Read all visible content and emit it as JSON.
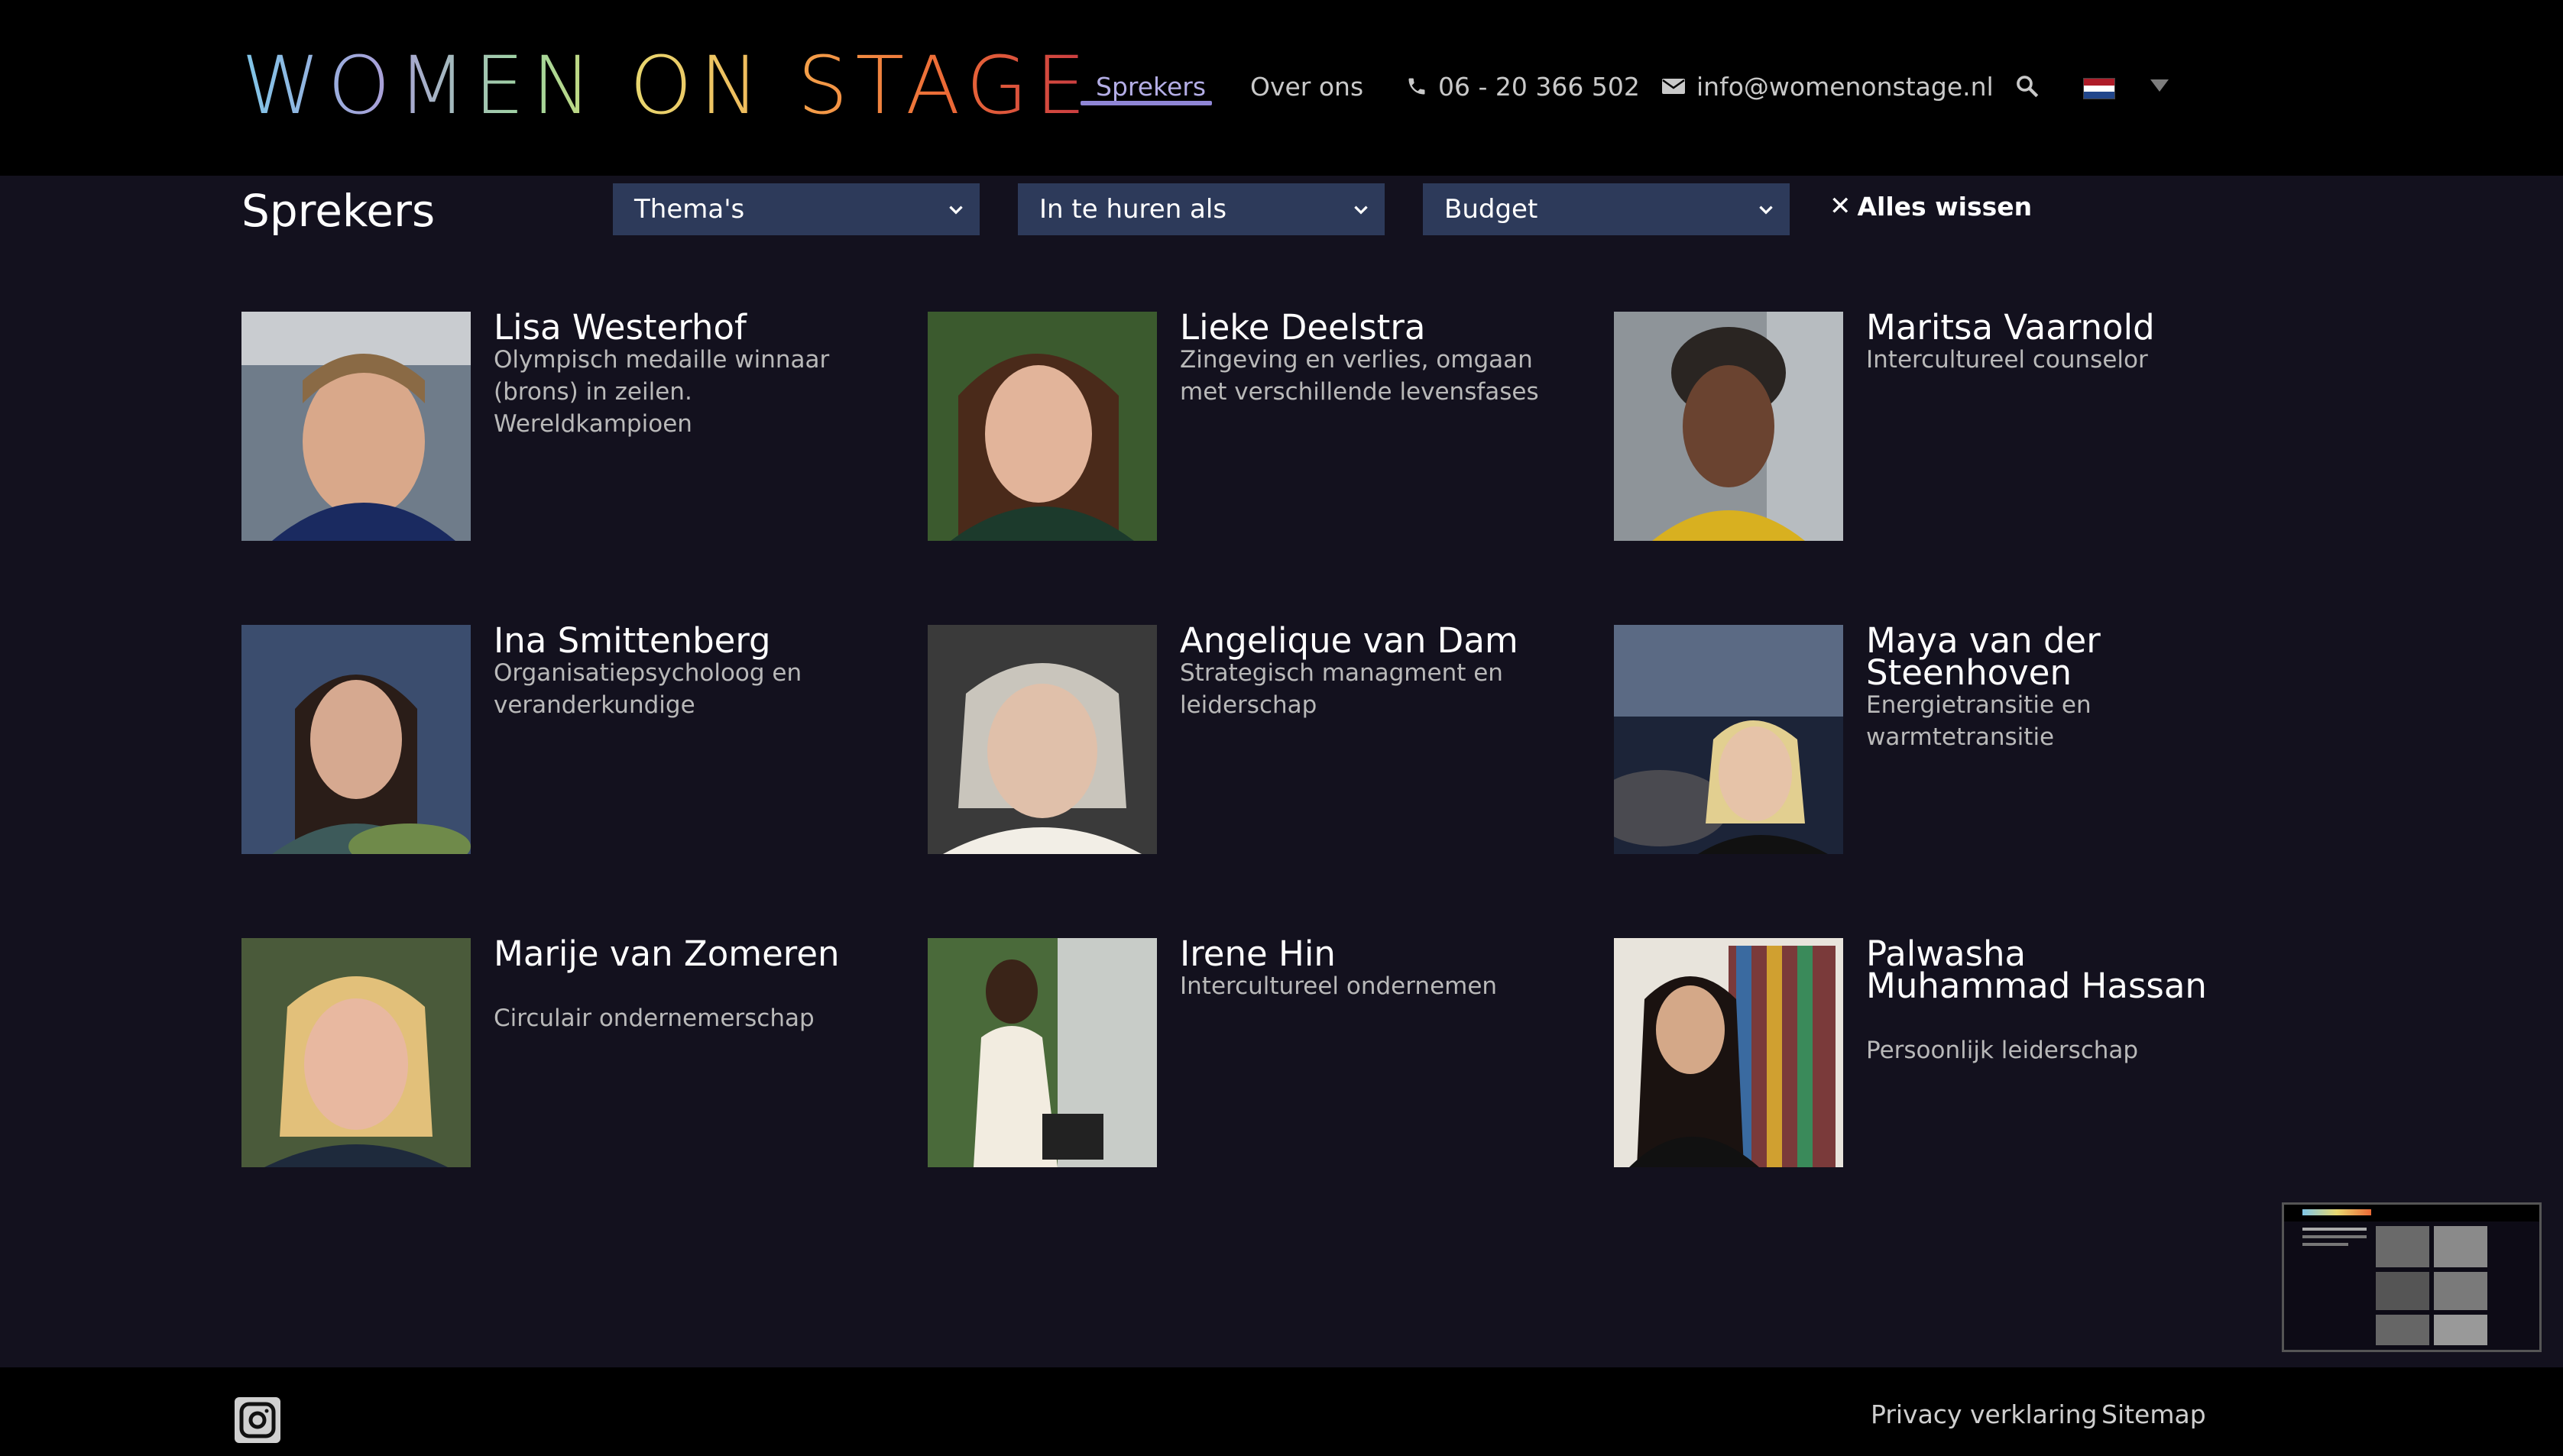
{
  "header": {
    "logo": {
      "word1": "WOMEN",
      "word2": "ON",
      "word3": "STAGE"
    },
    "nav": {
      "sprekers": "Sprekers",
      "over_ons": "Over ons",
      "phone": "06 - 20 366 502",
      "email": "info@womenonstage.nl"
    },
    "icons": {
      "search": "search-icon",
      "phone": "phone-icon",
      "email": "envelope-icon",
      "flag": "dutch-flag-icon",
      "dropdown": "caret-down-icon"
    },
    "flag_colors": [
      "#ae1c28",
      "#ffffff",
      "#21468b"
    ]
  },
  "filters": {
    "title": "Sprekers",
    "themas": "Thema's",
    "huren": "In te huren als",
    "budget": "Budget",
    "clear": "Alles wissen"
  },
  "speakers": [
    {
      "name": "Lisa Westerhof",
      "desc": "Olympisch medaille winnaar (brons) in zeilen. Wereldkampioen"
    },
    {
      "name": "Lieke Deelstra",
      "desc": "Zingeving en verlies, omgaan met verschillende levensfases"
    },
    {
      "name": "Maritsa Vaarnold",
      "desc": "Intercultureel counselor"
    },
    {
      "name": "Ina Smittenberg",
      "desc": "Organisatiepsycholoog en veranderkundige"
    },
    {
      "name": "Angelique van Dam",
      "desc": "Strategisch managment en leiderschap"
    },
    {
      "name": "Maya van der Steenhoven",
      "desc": "Energietransitie en warmtetransitie"
    },
    {
      "name": "Marije van Zomeren",
      "desc": "Circulair ondernemerschap"
    },
    {
      "name": "Irene Hin",
      "desc": "Intercultureel ondernemen"
    },
    {
      "name": "Palwasha Muhammad Hassan",
      "desc": "Persoonlijk leiderschap"
    }
  ],
  "footer": {
    "privacy": "Privacy verklaring",
    "sitemap": "Sitemap",
    "social_icon": "instagram-icon"
  },
  "colors": {
    "background": "#13111e",
    "header": "#000000",
    "select": "#2d3a5a",
    "accent": "#8f86d6"
  }
}
